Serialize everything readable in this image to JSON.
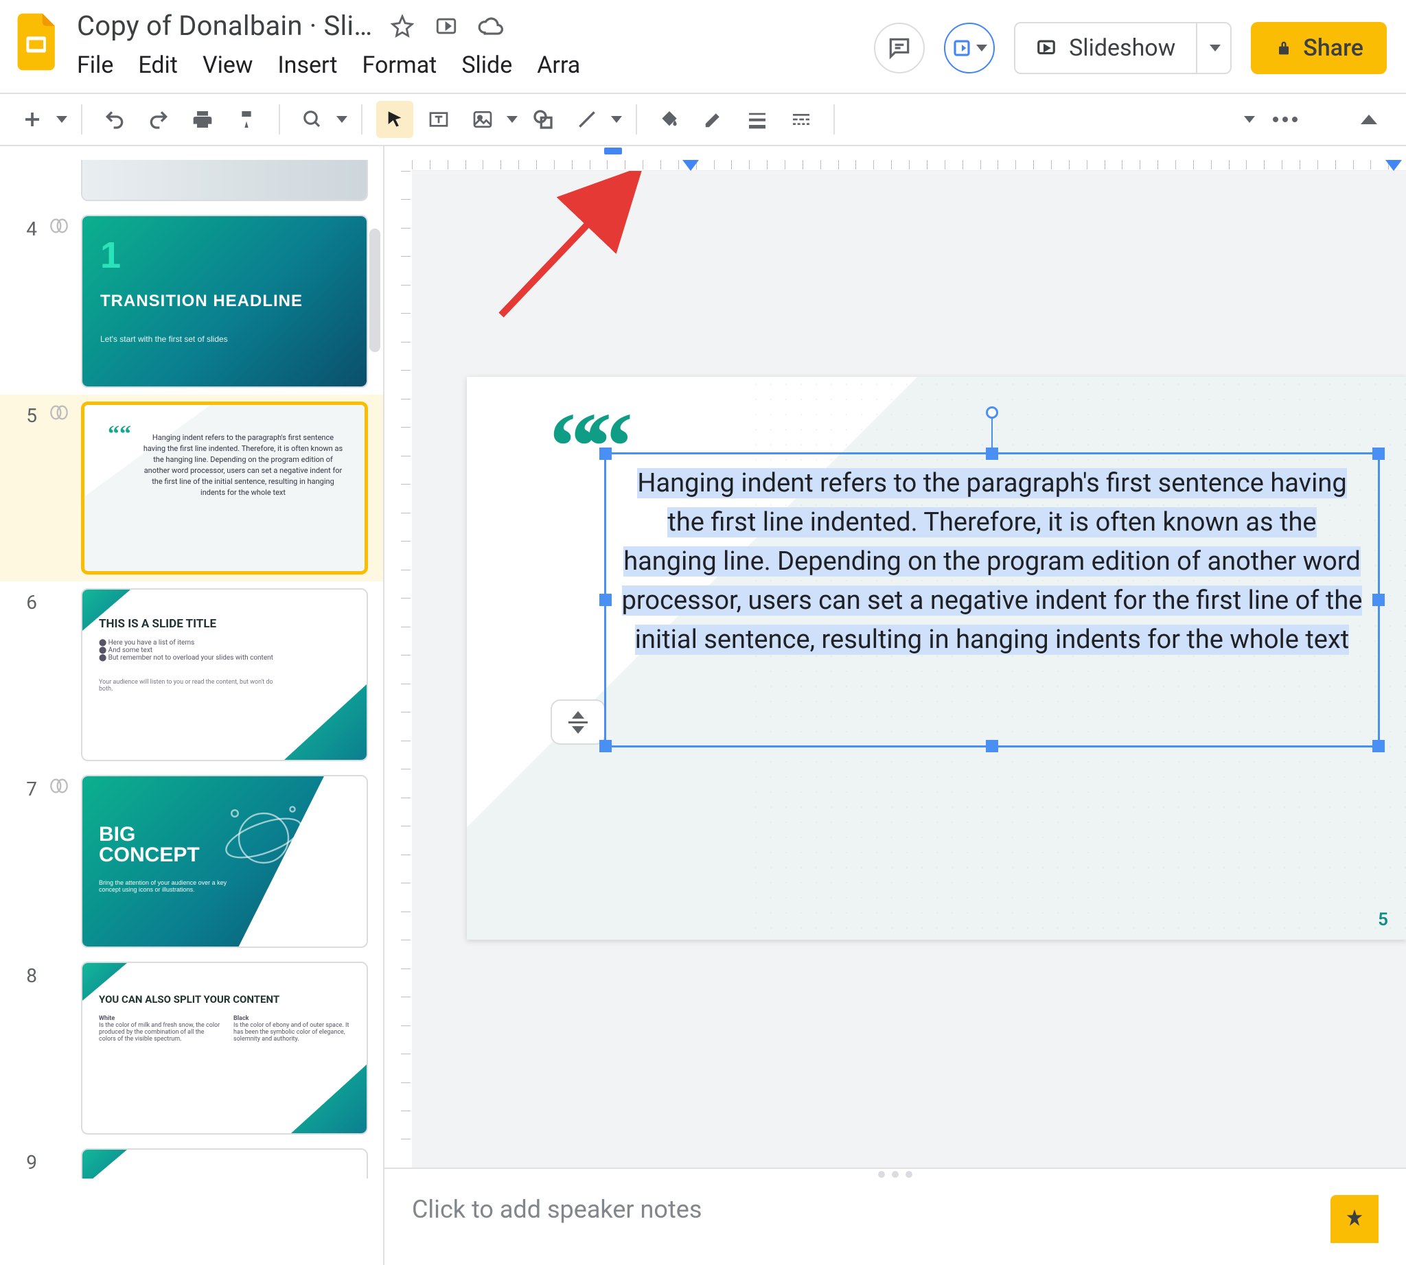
{
  "doc": {
    "title": "Copy of Donalbain · Sli…"
  },
  "menus": [
    "File",
    "Edit",
    "View",
    "Insert",
    "Format",
    "Slide",
    "Arra"
  ],
  "header": {
    "slideshow": "Slideshow",
    "share": "Share"
  },
  "thumbs": [
    {
      "num": "4",
      "kind": "transition",
      "big": "1",
      "title": "TRANSITION HEADLINE",
      "sub": "Let's start with the first set of slides"
    },
    {
      "num": "5",
      "kind": "quote",
      "selected": true,
      "text": "Hanging indent refers to the paragraph's first sentence having the first line indented. Therefore, it is often known as the hanging line. Depending on the program edition of another word processor, users can set a negative indent for the first line of the initial sentence, resulting in hanging indents for the whole text"
    },
    {
      "num": "6",
      "kind": "title",
      "title": "THIS IS A SLIDE TITLE",
      "bullets": [
        "Here you have a list of items",
        "And some text",
        "But remember not to overload your slides with content"
      ],
      "foot": "Your audience will listen to you or read the content, but won't do both."
    },
    {
      "num": "7",
      "kind": "big",
      "title1": "BIG",
      "title2": "CONCEPT",
      "sub": "Bring the attention of your audience over a key concept using icons or illustrations."
    },
    {
      "num": "8",
      "kind": "split",
      "title": "YOU CAN ALSO SPLIT YOUR CONTENT",
      "left_h": "White",
      "left_t": "Is the color of milk and fresh snow, the color produced by the combination of all the colors of the visible spectrum.",
      "right_h": "Black",
      "right_t": "Is the color of ebony and of outer space. It has been the symbolic color of elegance, solemnity and authority."
    },
    {
      "num": "9",
      "kind": "partial"
    }
  ],
  "slide": {
    "num": "5",
    "text": "Hanging indent refers to the paragraph's first sentence having the first line indented. Therefore, it is often known as the hanging line. Depending on the program edition of another word processor, users can set a negative indent for the first line of the initial sentence, resulting in hanging indents for the whole text"
  },
  "notes": {
    "placeholder": "Click to add speaker notes"
  }
}
